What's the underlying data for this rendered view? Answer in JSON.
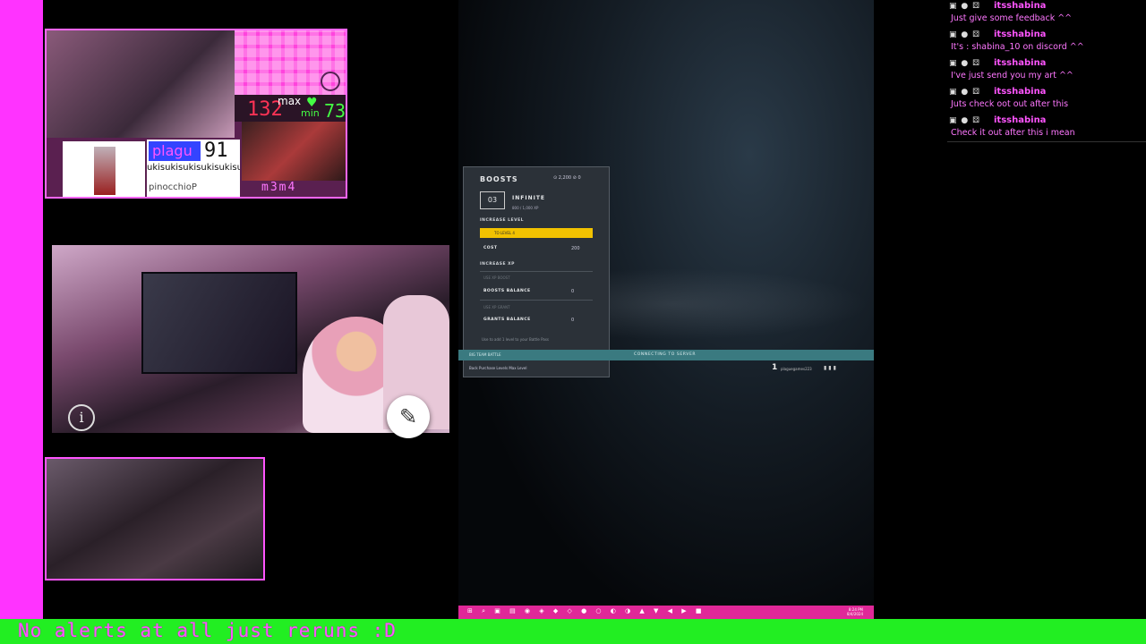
{
  "ticker": {
    "text": "No alerts at all just reruns :D"
  },
  "stats_widget": {
    "heart_rate": "132",
    "max_label": "max",
    "min_label": "min",
    "min_value": "73",
    "song_title": "plagu",
    "song_number": "91",
    "song_lyric": "ukisukisukisukisukisuki",
    "song_artist": "pinocchioP",
    "brand": "m3m4"
  },
  "webcam_controls": {
    "info_icon": "info-icon",
    "edit_icon": "pencil-icon"
  },
  "game": {
    "boosts": {
      "title": "BOOSTS",
      "credits": "⊙ 2,200  ⊘ 0",
      "level": "03",
      "level_name": "INFINITE",
      "level_xp": "800 / 1,000 XP",
      "increase_level": "INCREASE LEVEL",
      "to_level": "TO LEVEL 4",
      "cost_label": "COST",
      "cost_value": "200",
      "increase_xp": "INCREASE XP",
      "use_xp_boost": "USE XP BOOST",
      "boosts_balance_label": "BOOSTS BALANCE",
      "boosts_balance_value": "0",
      "use_xp_grant": "USE XP GRANT",
      "grants_balance_label": "GRANTS BALANCE",
      "grants_balance_value": "0",
      "note": "Use to add 1 level to your Battle Pass",
      "footer": "Back   Purchase Levels   Max Level"
    },
    "strip_left": "BIG TEAM BATTLE",
    "strip_center": "CONNECTING TO SERVER",
    "player_rank": "1",
    "player_name": "plaguegames223"
  },
  "taskbar": {
    "icons": "⊞ ⌕ ▣ ▤ ◉ ◈ ◆ ◇ ● ○ ◐ ◑ ▲ ▼ ◀ ▶ ■",
    "time": "8:24 PM",
    "date": "8/4/2024"
  },
  "chat": {
    "messages": [
      {
        "user": "itsshabina",
        "text": "Just give some feedback ^^"
      },
      {
        "user": "itsshabina",
        "text": "It's : shabina_10 on discord ^^"
      },
      {
        "user": "itsshabina",
        "text": "I've just send you my art ^^"
      },
      {
        "user": "itsshabina",
        "text": "Juts check oot out after this"
      },
      {
        "user": "itsshabina",
        "text": "Check it out after this i mean"
      }
    ],
    "badges": "▣ ● ⚄"
  },
  "colors": {
    "accent_pink": "#ff33ff",
    "ticker_green": "#22ee22",
    "boost_yellow": "#f2c200"
  }
}
